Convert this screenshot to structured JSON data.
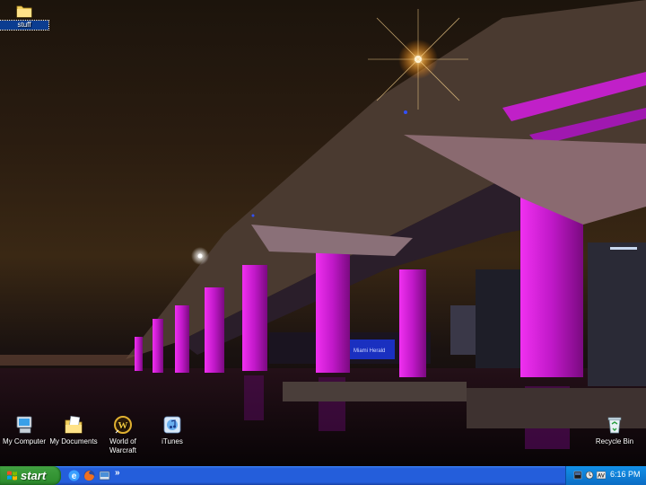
{
  "desktop": {
    "icons": [
      {
        "label": "stuff",
        "icon": "folder-icon"
      },
      {
        "label": "My Computer",
        "icon": "my-computer-icon"
      },
      {
        "label": "My Documents",
        "icon": "my-documents-icon"
      },
      {
        "label": "World of Warcraft",
        "icon": "world-of-warcraft-icon"
      },
      {
        "label": "iTunes",
        "icon": "itunes-icon"
      },
      {
        "label": "Recycle Bin",
        "icon": "recycle-bin-icon"
      }
    ],
    "wallpaper_sign": "Miami Herald"
  },
  "taskbar": {
    "start_label": "start",
    "quick_launch_more": "»",
    "clock": "6:16 PM"
  },
  "colors": {
    "taskbar_blue": "#245edb",
    "start_green": "#3c9d3c",
    "tray_blue": "#0f7fd6",
    "bridge_magenta": "#e020e0"
  }
}
